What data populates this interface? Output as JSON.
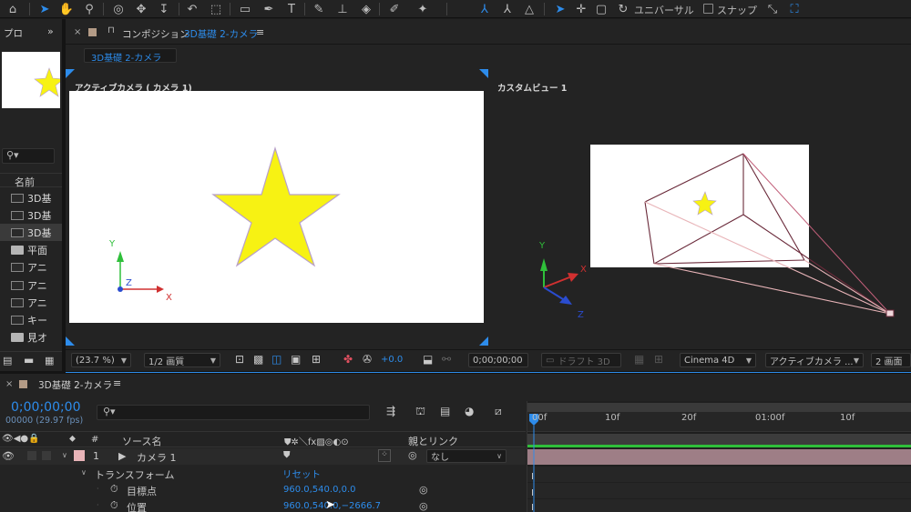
{
  "toolbar": {
    "unit_label": "ユニバーサル",
    "snap_label": "スナップ",
    "tools": [
      "home-icon",
      "selection-icon",
      "hand-icon",
      "zoom-icon",
      "orbit-icon",
      "pan-icon",
      "dolly-icon",
      "rotate-icon",
      "camera-icon",
      "rectangle-icon",
      "pen-icon",
      "type-icon",
      "brush-icon",
      "clone-stamp-icon",
      "eraser-icon",
      "roto-brush-icon",
      "pin-icon"
    ]
  },
  "project": {
    "tab": "プロ",
    "col_name": "名前",
    "items": [
      {
        "label": "3D基",
        "type": "comp"
      },
      {
        "label": "3D基",
        "type": "comp"
      },
      {
        "label": "3D基",
        "type": "comp"
      },
      {
        "label": "平面",
        "type": "folder"
      },
      {
        "label": "アニ",
        "type": "comp"
      },
      {
        "label": "アニ",
        "type": "comp"
      },
      {
        "label": "アニ",
        "type": "comp"
      },
      {
        "label": "キー",
        "type": "comp"
      },
      {
        "label": "見オ",
        "type": "folder"
      }
    ]
  },
  "composition": {
    "tab_prefix": "コンポジション",
    "tab_name": "3D基礎 2-カメラ",
    "breadcrumb": "3D基礎 2-カメラ",
    "left_view_label": "アクティブカメラ ( カメラ 1)",
    "right_view_label": "カスタムビュー 1",
    "axis_x": "X",
    "axis_y": "Y",
    "axis_z": "Z",
    "zoom": "(23.7 %)",
    "resolution": "1/2 画質",
    "exposure": "+0.0",
    "timecode": "0;00;00;00",
    "draft_3d": "ドラフト 3D",
    "renderer": "Cinema 4D",
    "view_camera": "アクティブカメラ ...",
    "view_layout": "2 画面"
  },
  "timeline": {
    "tab": "3D基礎 2-カメラ",
    "timecode": "0;00;00;00",
    "fps": "00000 (29.97 fps)",
    "col_num": "#",
    "col_source": "ソース名",
    "col_parent": "親とリンク",
    "ruler": [
      "00f",
      "10f",
      "20f",
      "01:00f",
      "10f"
    ],
    "layer": {
      "num": "1",
      "name": "カメラ 1",
      "parent": "なし"
    },
    "transform_label": "トランスフォーム",
    "reset_label": "リセット",
    "properties": [
      {
        "name": "目標点",
        "value": "960.0,540.0,0.0"
      },
      {
        "name": "位置",
        "value": "960.0,540.0,−2666.7"
      }
    ]
  },
  "colors": {
    "accent": "#2d8ceb",
    "star": "#f7f213",
    "star_stroke": "#b8a0c8",
    "camera_label": "#e8b4b8"
  }
}
